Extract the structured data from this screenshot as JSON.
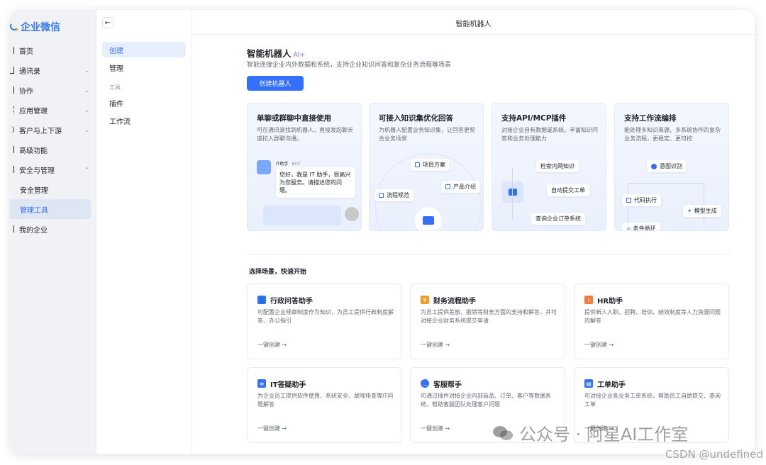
{
  "sidebar": {
    "logo": "企业微信",
    "items": [
      {
        "label": "首页",
        "chev": ""
      },
      {
        "label": "通讯录",
        "chev": "⌄"
      },
      {
        "label": "协作",
        "chev": "⌄"
      },
      {
        "label": "应用管理",
        "chev": "⌄"
      },
      {
        "label": "客户与上下游",
        "chev": "⌄"
      },
      {
        "label": "高级功能",
        "chev": ""
      },
      {
        "label": "安全与管理",
        "chev": "⌃"
      }
    ],
    "sub_items": [
      "安全管理",
      "管理工具"
    ],
    "last_item": "我的企业"
  },
  "menu2": {
    "back": "←",
    "items": [
      "创建",
      "管理"
    ],
    "group": "工具",
    "tools": [
      "插件",
      "工作流"
    ]
  },
  "header": {
    "title": "智能机器人"
  },
  "main": {
    "title": "智能机器人",
    "ai_tag": "AI+",
    "subtitle": "智能连接企业内外数据和系统，支持企业知识问答和复杂业务流程等场景",
    "create_button": "创建机器人",
    "features": [
      {
        "title": "单聊或群聊中直接使用",
        "desc": "可在通讯录找到机器人，直接发起聊天或拉入群聊沟通。"
      },
      {
        "title": "可接入知识集优化回答",
        "desc": "为机器人配置业务知识集，让回答更契合业务场景"
      },
      {
        "title": "支持API/MCP插件",
        "desc": "对接企业自有数据或系统，丰富知识问答和业务处理能力"
      },
      {
        "title": "支持工作流编排",
        "desc": "能处理多知识来源、多系统协作的复杂业务流程，更稳定、更可控"
      }
    ],
    "chat_demo": {
      "name": "IT助手",
      "bot": "BOT",
      "message": "您好，我是 IT 助手，很高兴为您服务。请描述您的问题。"
    },
    "knowledge_pills": [
      "项目方案",
      "产品介绍",
      "流程规范"
    ],
    "plugin_pills": [
      "检索内网知识",
      "自动提交工单",
      "查询企业订单系统"
    ],
    "workflow_pills": [
      "意图识别",
      "代码执行",
      "模型生成",
      "条件循环"
    ],
    "section_title": "选择场景，快速开始",
    "templates": [
      {
        "name": "行政问答助手",
        "desc": "可配置企业规章制度作为知识，为员工提供行政制度解答、办公指引",
        "link": "一键创建 →",
        "color": "#3370ff",
        "icon": "person-icon"
      },
      {
        "name": "财务流程助手",
        "desc": "为员工提供差旅、报销等财务方面的支持和解答，并可对接企业财务系统提交申请",
        "link": "一键创建 →",
        "color": "#f59a23",
        "icon": "yen-icon"
      },
      {
        "name": "HR助手",
        "desc": "提供新人入职、招聘、培训、绩效制度等人力资源问题的解答",
        "link": "一键创建 →",
        "color": "#f57a3d",
        "icon": "hr-icon"
      },
      {
        "name": "IT答疑助手",
        "desc": "为企业员工提供软件使用、系统安全、故障排查等IT问题解答",
        "link": "一键创建 →",
        "color": "#3370ff",
        "icon": "server-icon"
      },
      {
        "name": "客服帮手",
        "desc": "可通过插件对接企业内部商品、订单、客户等数据系统，帮助客服团队处理客户问题",
        "link": "一键创建 →",
        "color": "#3370ff",
        "icon": "chat-icon"
      },
      {
        "name": "工单助手",
        "desc": "可对接企业各业务工单系统，帮助员工自助提交、查询工单",
        "link": "一键创建 →",
        "color": "#3370ff",
        "icon": "ticket-icon"
      }
    ]
  },
  "watermark": {
    "text": "公众号 · 阿星AI工作室",
    "csdn": "CSDN @undefined"
  }
}
